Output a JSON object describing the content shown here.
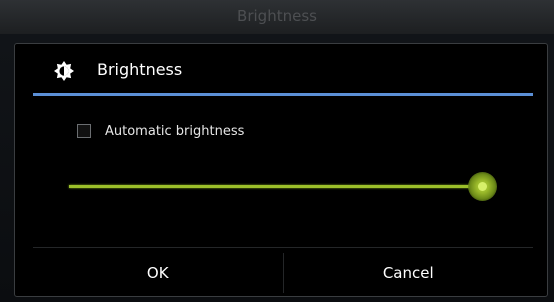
{
  "background_window": {
    "title": "Brightness"
  },
  "dialog": {
    "title": "Brightness",
    "title_icon": "brightness-icon",
    "accent_color": "#5b8fd6",
    "automatic_brightness": {
      "label": "Automatic brightness",
      "checked": false
    },
    "brightness_slider": {
      "value_fraction": 0.97,
      "color": "#9cc02a"
    },
    "buttons": {
      "ok_label": "OK",
      "cancel_label": "Cancel"
    }
  }
}
